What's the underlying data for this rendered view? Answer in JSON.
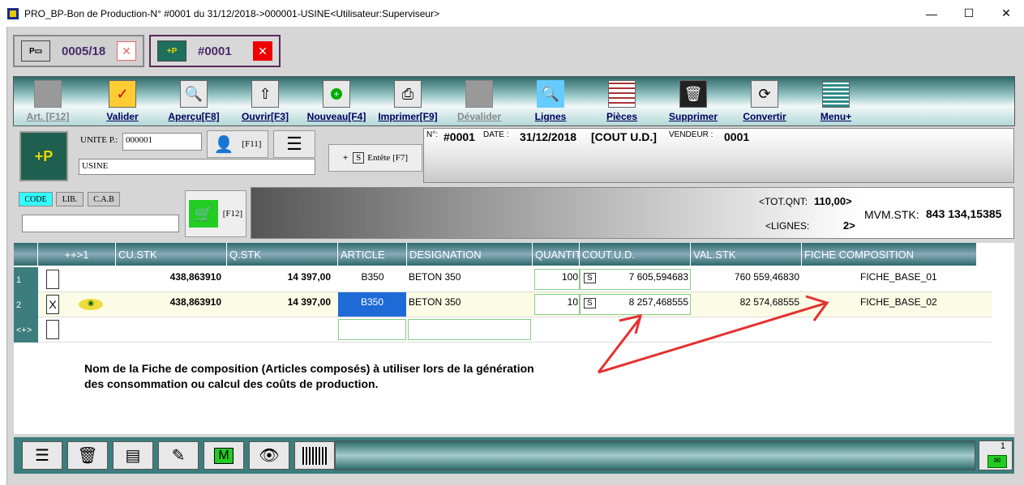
{
  "window": {
    "title": "PRO_BP-Bon de Production-N° #0001 du 31/12/2018->000001-USINE<Utilisateur:Superviseur>",
    "minimize": "—",
    "maximize": "☐",
    "close": "✕"
  },
  "tabs": [
    {
      "label": "0005/18",
      "thumb": "P▭"
    },
    {
      "label": "#0001",
      "thumb": "+P"
    }
  ],
  "toolbar": [
    "Art. [F12]",
    "Valider",
    "Aperçu[F8]",
    "Ouvrir[F3]",
    "Nouveau[F4]",
    "Imprimer[F9]",
    "Dévalider",
    "Lignes",
    "Pièces",
    "Supprimer",
    "Convertir",
    "Menu+"
  ],
  "header": {
    "unite_label": "UNITE P.:",
    "unite_code": "000001",
    "unite_name": "USINE",
    "user_key": "[F11]",
    "entete": "Entête [F7]",
    "entete_s": "S",
    "entete_plus": "+",
    "logo_text": "+P"
  },
  "info": {
    "n_label": "N°:",
    "n_value": "#0001",
    "date_label": "DATE :",
    "date_value": "31/12/2018",
    "type_value": "[COUT U.D.]",
    "vendeur_label": "VENDEUR :",
    "vendeur_value": "0001",
    "tot_label": "<TOT.QNT:",
    "tot_value": "110,00>",
    "lignes_label": "<LIGNES:",
    "lignes_value": "2>",
    "mvm_label": "MVM.STK:",
    "mvm_value": "843 134,15385"
  },
  "search": {
    "tabs": [
      "CODE",
      "LIB.",
      "C.A.B"
    ],
    "cart_key": "[F12]"
  },
  "grid": {
    "columns": [
      "++>1",
      "CU.STK",
      "Q.STK",
      "ARTICLE",
      "DESIGNATION",
      "QUANTIT",
      "COUT.U.D.",
      "VAL.STK",
      "FICHE COMPOSITION"
    ],
    "rows": [
      {
        "num": "1",
        "check": "",
        "cu": "438,863910",
        "q": "14 397,00",
        "article": "B350",
        "designation": "BETON 350",
        "quantite": "100",
        "cout_s": "S",
        "cout": "7 605,594683",
        "val": "760 559,46830",
        "fiche": "FICHE_BASE_01"
      },
      {
        "num": "2",
        "check": "X",
        "cu": "438,863910",
        "q": "14 397,00",
        "article": "B350",
        "designation": "BETON 350",
        "quantite": "10",
        "cout_s": "S",
        "cout": "8 257,468555",
        "val": "82 574,68555",
        "fiche": "FICHE_BASE_02"
      }
    ],
    "new_row": "<+>"
  },
  "annotation": {
    "line1": "Nom de la Fiche de composition (Articles composés) à utiliser lors de la génération",
    "line2": "des consommation ou calcul des coûts de production."
  },
  "bottom": {
    "counter": "1"
  },
  "colors": {
    "teal": "#2d6a6a",
    "accent_red": "#e53030"
  }
}
